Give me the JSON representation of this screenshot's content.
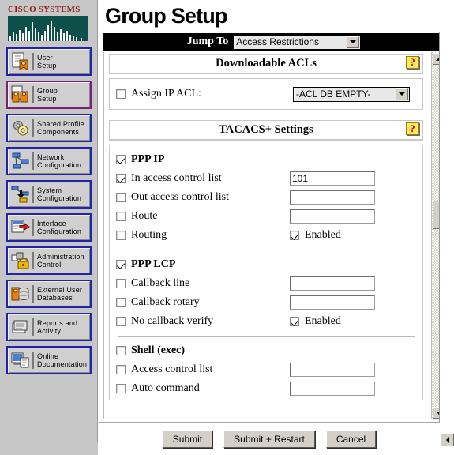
{
  "brand": {
    "name_line": "CISCO SYSTEMS",
    "bridge_icon": "cisco-bridge-logo"
  },
  "sidebar": {
    "items": [
      {
        "label": "User\nSetup",
        "icon": "user-setup-icon",
        "active": false
      },
      {
        "label": "Group\nSetup",
        "icon": "group-setup-icon",
        "active": true
      },
      {
        "label": "Shared Profile\nComponents",
        "icon": "shared-profile-icon",
        "active": false
      },
      {
        "label": "Network\nConfiguration",
        "icon": "network-config-icon",
        "active": false
      },
      {
        "label": "System\nConfiguration",
        "icon": "system-config-icon",
        "active": false
      },
      {
        "label": "Interface\nConfiguration",
        "icon": "interface-config-icon",
        "active": false
      },
      {
        "label": "Administration\nControl",
        "icon": "administration-control-icon",
        "active": false
      },
      {
        "label": "External User\nDatabases",
        "icon": "external-user-databases-icon",
        "active": false
      },
      {
        "label": "Reports and\nActivity",
        "icon": "reports-activity-icon",
        "active": false
      },
      {
        "label": "Online\nDocumentation",
        "icon": "online-documentation-icon",
        "active": false
      }
    ]
  },
  "header": {
    "title": "Group Setup"
  },
  "jump_to": {
    "label": "Jump To",
    "selected": "Access Restrictions"
  },
  "downloadable_acls": {
    "heading": "Downloadable ACLs",
    "help_glyph": "?",
    "assign_ip_acl": {
      "label": "Assign IP ACL:",
      "checked": false,
      "selected": "-ACL DB EMPTY-"
    }
  },
  "tacacs_settings": {
    "heading": "TACACS+ Settings",
    "help_glyph": "?",
    "groups": [
      {
        "title": "PPP IP",
        "title_checked": true,
        "rows": [
          {
            "label": "In access control list",
            "checked": true,
            "control": "text",
            "value": "101"
          },
          {
            "label": "Out access control list",
            "checked": false,
            "control": "text",
            "value": ""
          },
          {
            "label": "Route",
            "checked": false,
            "control": "text",
            "value": ""
          },
          {
            "label": "Routing",
            "checked": false,
            "control": "enabled",
            "enabled_label": "Enabled",
            "enabled_checked": true
          }
        ]
      },
      {
        "title": "PPP LCP",
        "title_checked": true,
        "rows": [
          {
            "label": "Callback line",
            "checked": false,
            "control": "text",
            "value": ""
          },
          {
            "label": "Callback rotary",
            "checked": false,
            "control": "text",
            "value": ""
          },
          {
            "label": "No callback verify",
            "checked": false,
            "control": "enabled",
            "enabled_label": "Enabled",
            "enabled_checked": true
          }
        ]
      },
      {
        "title": "Shell (exec)",
        "title_checked": false,
        "rows": [
          {
            "label": "Access control list",
            "checked": false,
            "control": "text",
            "value": ""
          },
          {
            "label": "Auto command",
            "checked": false,
            "control": "text",
            "value": ""
          }
        ]
      }
    ]
  },
  "buttons": {
    "submit": "Submit",
    "submit_restart": "Submit + Restart",
    "cancel": "Cancel"
  },
  "colors": {
    "brand_red": "#8c1919",
    "logo_green": "#0d4f4a",
    "nav_border": "#2222aa",
    "nav_border_active": "#7a1f7a",
    "sidebar_bg": "#c6c6c6",
    "jump_bar_bg": "#000000",
    "help_bg": "#ffe95c"
  }
}
